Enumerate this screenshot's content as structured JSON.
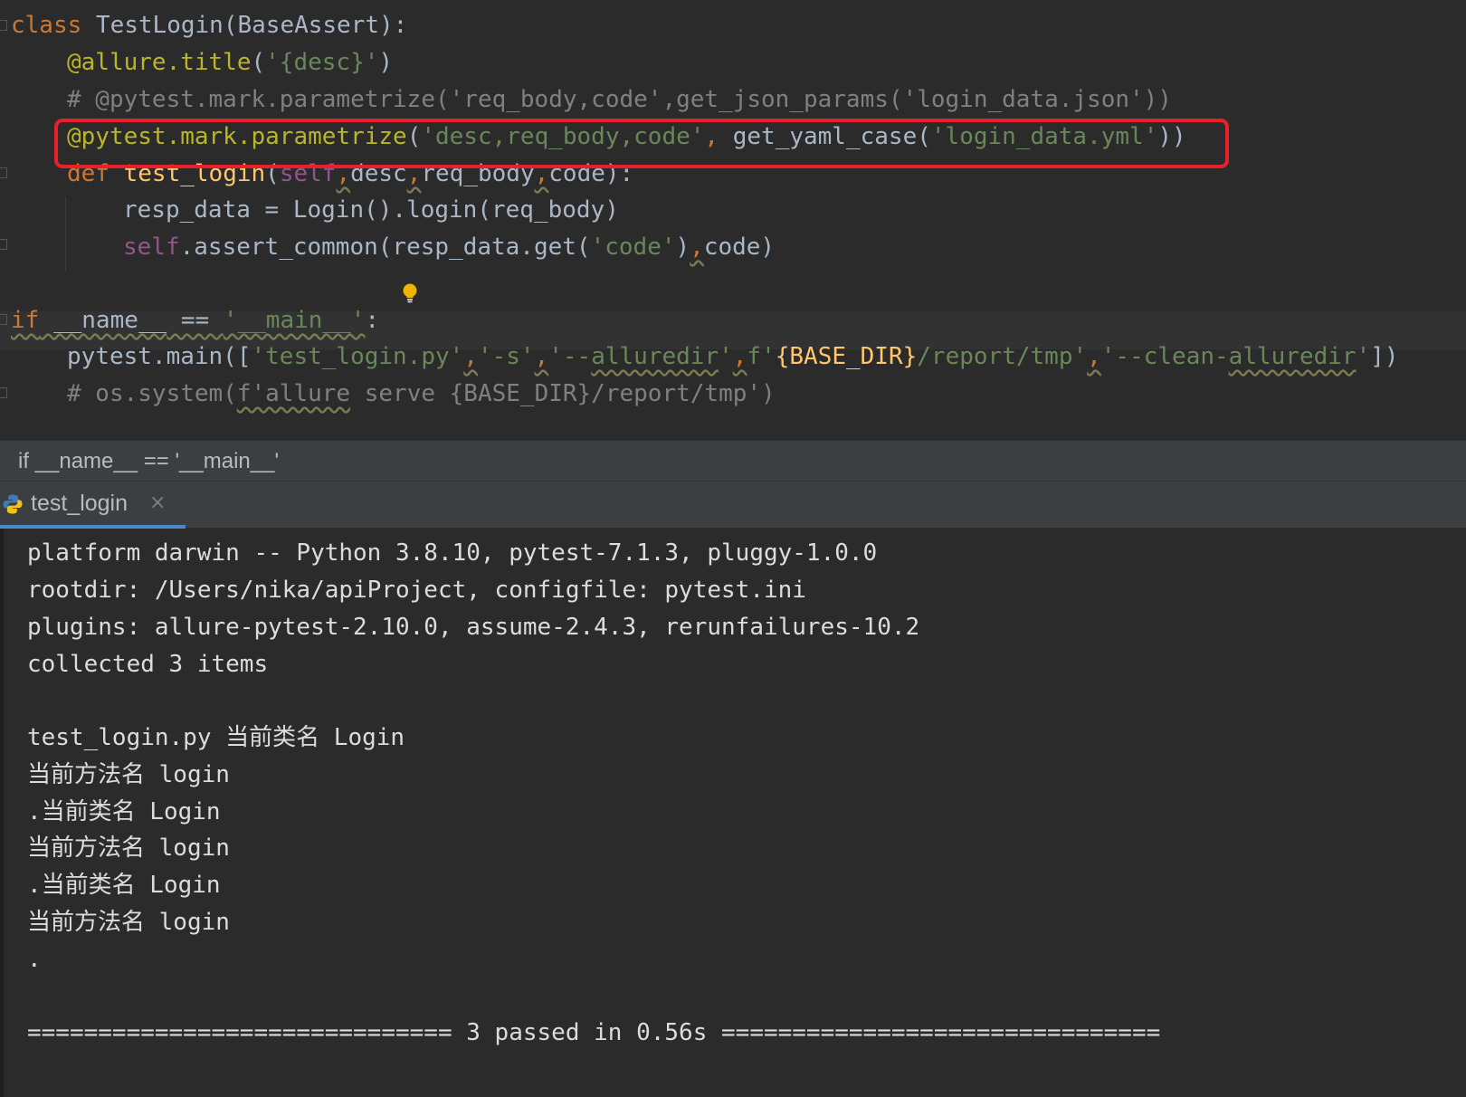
{
  "editor": {
    "l1_kw": "class",
    "l1_name": " TestLogin",
    "l1_rest": "(BaseAssert):",
    "l2_deco": "@allure.title",
    "l2_p1": "(",
    "l2_str": "'{desc}'",
    "l2_p2": ")",
    "l3_comment": "# @pytest.mark.parametrize('req_body,code',get_json_params('login_data.json'))",
    "l4_deco": "@pytest.mark.parametrize",
    "l4_p1": "(",
    "l4_str1": "'desc,req_body,code'",
    "l4_comma": ",",
    "l4_mid": " get_yaml_case(",
    "l4_str2": "'login_data.yml'",
    "l4_p2": "))",
    "l5_kw": "def",
    "l5_fn": " test_login",
    "l5_p": "(",
    "l5_self": "self",
    "l5_c1": ",",
    "l5_a1": "desc",
    "l5_c2": ",",
    "l5_a2": "req_body",
    "l5_c3": ",",
    "l5_a3": "code):",
    "l6": "resp_data = Login().login(req_body)",
    "l7_self": "self",
    "l7_a": ".assert_common(resp_data.get(",
    "l7_str": "'code'",
    "l7_b": ")",
    "l7_c": ",",
    "l7_d": "code)",
    "l9_kw": "if",
    "l9_name": " __name__",
    "l9_eq": " == ",
    "l9_str": "'__main__'",
    "l9_colon": ":",
    "l10_a": "pytest.main([",
    "l10_s1": "'test_login.py'",
    "l10_c1": ",",
    "l10_s2": "'-s'",
    "l10_c2": ",",
    "l10_s3a": "'--",
    "l10_s3b": "alluredir",
    "l10_s3c": "'",
    "l10_c3": ",",
    "l10_f": "f'",
    "l10_brace": "{BASE_DIR}",
    "l10_s4": "/report/tmp'",
    "l10_c4": ",",
    "l10_s5a": "'--clean-",
    "l10_s5b": "alluredir",
    "l10_s5c": "'",
    "l10_end": "])",
    "l11_a": "# os.system(",
    "l11_b": "f'allure",
    "l11_c": " serve {BASE_DIR}/report/tmp')"
  },
  "breadcrumb": "if __name__ == '__main__'",
  "run_tab": {
    "label": "test_login",
    "close": "×"
  },
  "console": [
    "platform darwin -- Python 3.8.10, pytest-7.1.3, pluggy-1.0.0",
    "rootdir: /Users/nika/apiProject, configfile: pytest.ini",
    "plugins: allure-pytest-2.10.0, assume-2.4.3, rerunfailures-10.2",
    "collected 3 items",
    "",
    "test_login.py 当前类名 Login",
    "当前方法名 login",
    ".当前类名 Login",
    "当前方法名 login",
    ".当前类名 Login",
    "当前方法名 login",
    ".",
    "",
    "============================== 3 passed in 0.56s ==============================="
  ],
  "colors": {
    "keyword": "#cc7832",
    "decorator": "#bbb529",
    "string": "#6a8759",
    "comment": "#808080",
    "self": "#94558d",
    "function": "#ffc66d",
    "highlight_box": "#e8202a",
    "background": "#2b2b2b"
  },
  "icons": [
    "lightbulb-icon",
    "python-icon",
    "close-icon",
    "fold-marker-icon"
  ]
}
